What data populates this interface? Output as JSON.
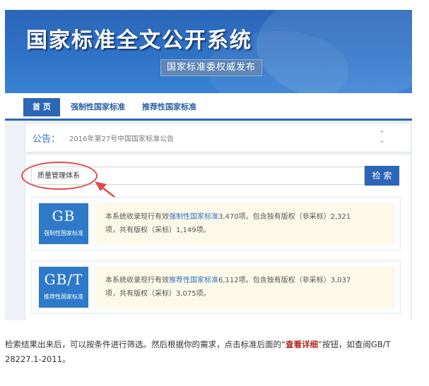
{
  "banner": {
    "title": "国家标准全文公开系统",
    "subtitle": "国家标准委权威发布"
  },
  "nav": {
    "items": [
      "首 页",
      "强制性国家标准",
      "推荐性国家标准"
    ]
  },
  "notice": {
    "label": "公告：",
    "text": "2016年第27号中国国家标准公告",
    "toggle_icon": "updown-chevron-icon"
  },
  "search": {
    "value": "质量管理体系",
    "button_label": "检 索"
  },
  "annotation": {
    "color": "#e24a4a"
  },
  "cards": [
    {
      "code": "GB",
      "sub": "强制性国家标准",
      "line1_prefix": "本系统收录现行有效",
      "line1_highlight": "强制性国家标准",
      "line1_suffix": "3,470项。包含独有版权（非采标）2,321",
      "line2": "项，共有版权（采标）1,149项。"
    },
    {
      "code": "GB/T",
      "sub": "推荐性国家标准",
      "line1_prefix": "本系统收录现行有效",
      "line1_highlight": "推荐性国家标准",
      "line1_suffix": "6,112项。包含独有版权（非采标）3,037",
      "line2": "项，共有版权（采标）3,075项。"
    }
  ],
  "caption": {
    "part1": "检索结果出来后，可以按条件进行筛选。然后根据你的需求，点击标准后面的“",
    "emphasis": "查看详细",
    "part2": "”按钮，如查阅GB/T 28227.1-2011。"
  },
  "colors": {
    "brand_blue": "#2c66b6",
    "highlight_yellow": "#fdf9e8"
  }
}
